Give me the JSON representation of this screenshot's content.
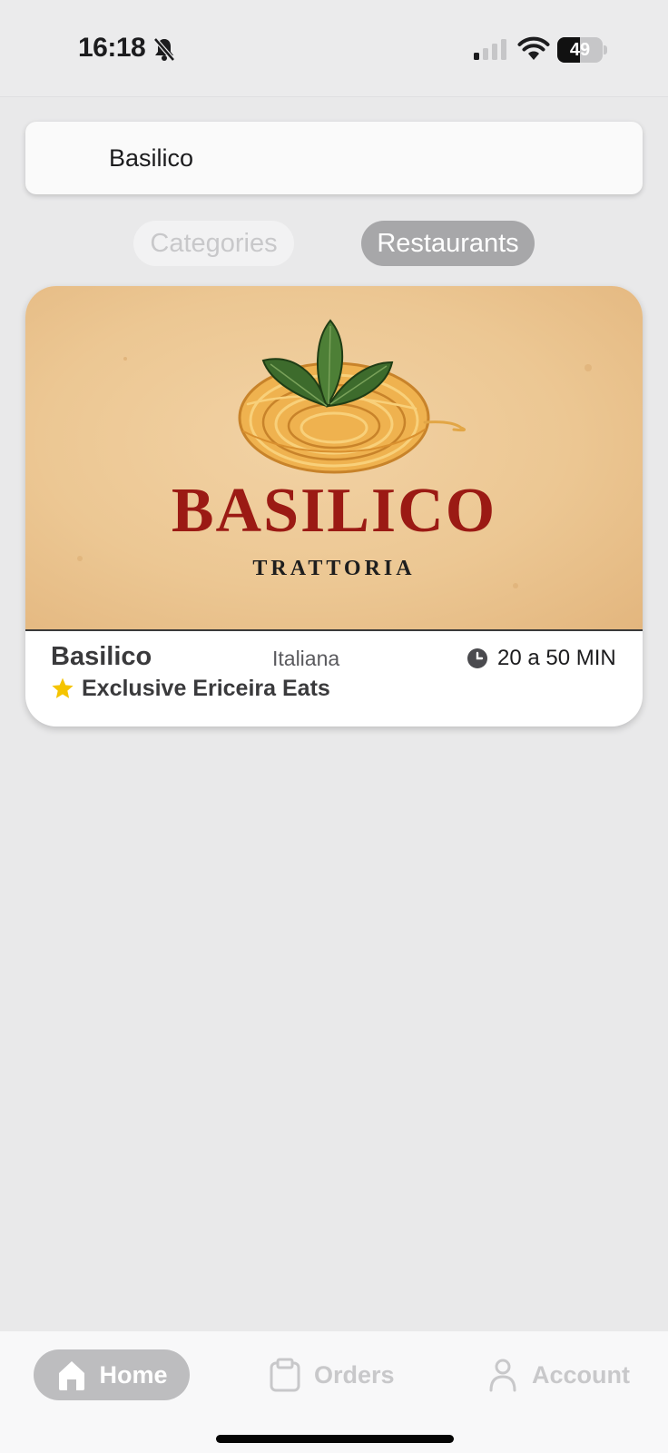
{
  "status_bar": {
    "time": "16:18",
    "battery_text": "49",
    "battery_level": 0.49
  },
  "search": {
    "value": "Basilico"
  },
  "segments": {
    "categories_label": "Categories",
    "restaurants_label": "Restaurants",
    "selected": "Restaurants"
  },
  "restaurant": {
    "banner_title": "BASILICO",
    "banner_subtitle": "TRATTORIA",
    "name": "Basilico",
    "cuisine": "Italiana",
    "delivery_time": "20 a 50 MIN",
    "tag": "Exclusive Ericeira Eats",
    "tag_icon": "star-icon",
    "time_icon": "clock-icon"
  },
  "nav": {
    "home_label": "Home",
    "orders_label": "Orders",
    "account_label": "Account",
    "active": "Home"
  },
  "colors": {
    "brand_red": "#9b1a14",
    "star_yellow": "#f5c400",
    "background": "#e9e9ea"
  }
}
